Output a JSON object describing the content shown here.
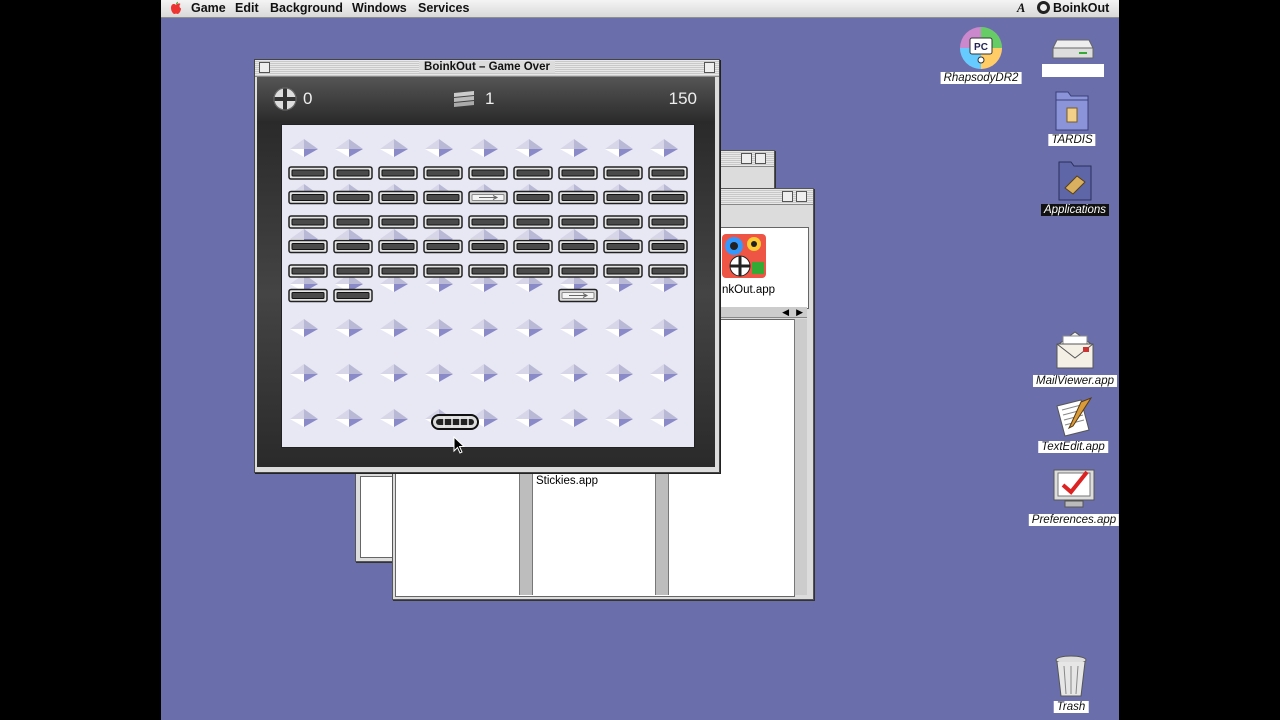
{
  "menubar": {
    "items": [
      "Game",
      "Edit",
      "Background",
      "Windows",
      "Services"
    ],
    "right_letter": "A",
    "app_name": "BoinkOut"
  },
  "game_window": {
    "title": "BoinkOut – Game Over",
    "lives": "0",
    "level": "1",
    "score": "150"
  },
  "background_windows": {
    "boinkout_label": "nkOut.app",
    "stickies_label": "Stickies.app"
  },
  "desktop_icons": [
    {
      "label": "RhapsodyDR2",
      "icon": "pc-cd-icon"
    },
    {
      "label": "",
      "icon": "hard-drive-icon"
    },
    {
      "label": "TARDIS",
      "icon": "folder-icon"
    },
    {
      "label": "Applications",
      "icon": "applications-folder-icon",
      "selected": true
    },
    {
      "label": "MailViewer.app",
      "icon": "mail-icon"
    },
    {
      "label": "TextEdit.app",
      "icon": "textedit-icon"
    },
    {
      "label": "Preferences.app",
      "icon": "preferences-icon"
    },
    {
      "label": "Trash",
      "icon": "trash-icon"
    }
  ],
  "colors": {
    "desktop": "#6a6fab",
    "brick_fill": "#4a4a4a",
    "brick_rim": "#e4e4e4",
    "field": "#e8e8f4"
  },
  "bricks": {
    "rows": 6,
    "cols": 9,
    "remaining_in_last_row": [
      0,
      1
    ],
    "special": [
      [
        1,
        4
      ],
      [
        5,
        6
      ]
    ]
  }
}
